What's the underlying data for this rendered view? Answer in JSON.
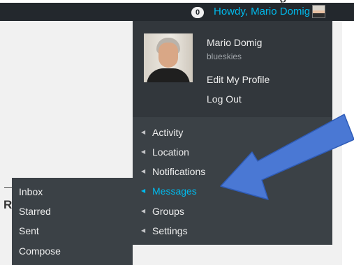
{
  "top_text": "g",
  "admin_bar": {
    "notification_count": "0",
    "greeting": "Howdy, Mario Domig"
  },
  "page": {
    "partial_heading": "R"
  },
  "profile": {
    "display_name": "Mario Domig",
    "username": "blueskies",
    "edit_profile_label": "Edit My Profile",
    "logout_label": "Log Out"
  },
  "menu": {
    "items": [
      {
        "label": "Activity",
        "active": false
      },
      {
        "label": "Location",
        "active": false
      },
      {
        "label": "Notifications",
        "active": false
      },
      {
        "label": "Messages",
        "active": true
      },
      {
        "label": "Groups",
        "active": false
      },
      {
        "label": "Settings",
        "active": false
      }
    ],
    "messages_submenu": [
      {
        "label": "Inbox"
      },
      {
        "label": "Starred"
      },
      {
        "label": "Sent"
      },
      {
        "label": "Compose"
      }
    ]
  },
  "colors": {
    "admin_bar_bg": "#23282d",
    "menu_bg": "#32373c",
    "submenu_bg": "#3b4146",
    "link_active": "#00b9eb",
    "annotation_arrow": "#4a78d4"
  },
  "icons": {
    "menu_arrow": "caret-left-icon",
    "annotation": "blue-arrow-icon"
  }
}
